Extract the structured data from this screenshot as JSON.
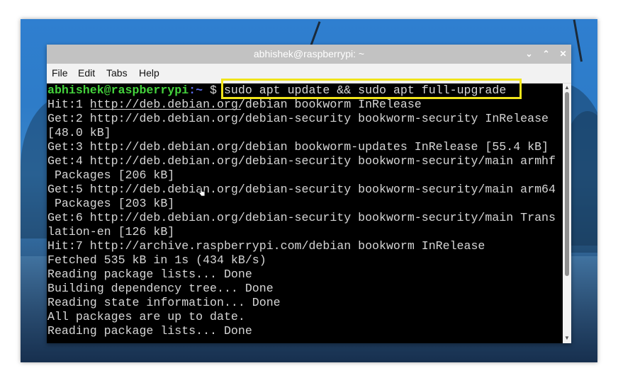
{
  "window": {
    "title": "abhishek@raspberrypi: ~",
    "minimize_glyph": "⌄",
    "maximize_glyph": "⌃",
    "close_glyph": "✕"
  },
  "menu": [
    "File",
    "Edit",
    "Tabs",
    "Help"
  ],
  "prompt": {
    "user": "abhishek@raspberrypi",
    "path": ":~",
    "symbol": " $",
    "command": " sudo apt update && sudo apt full-upgrade"
  },
  "output": [
    "Hit:1 http://deb.debian.org/debian bookworm InRelease",
    "Get:2 http://deb.debian.org/debian-security bookworm-security InRelease",
    "[48.0 kB]",
    "Get:3 http://deb.debian.org/debian bookworm-updates InRelease [55.4 kB]",
    "Get:4 http://deb.debian.org/debian-security bookworm-security/main armhf",
    " Packages [206 kB]",
    "Get:5 http://deb.debian.org/debian-security bookworm-security/main arm64",
    " Packages [203 kB]",
    "Get:6 http://deb.debian.org/debian-security bookworm-security/main Trans",
    "lation-en [126 kB]",
    "Hit:7 http://archive.raspberrypi.com/debian bookworm InRelease",
    "Fetched 535 kB in 1s (434 kB/s)",
    "Reading package lists... Done",
    "Building dependency tree... Done",
    "Reading state information... Done",
    "All packages are up to date.",
    "Reading package lists... Done"
  ],
  "colors": {
    "prompt_user": "#44d23c",
    "prompt_path": "#5c6ef2",
    "highlight_box": "#f0e41a",
    "terminal_bg": "#000000",
    "terminal_text": "#d6d6d6"
  }
}
